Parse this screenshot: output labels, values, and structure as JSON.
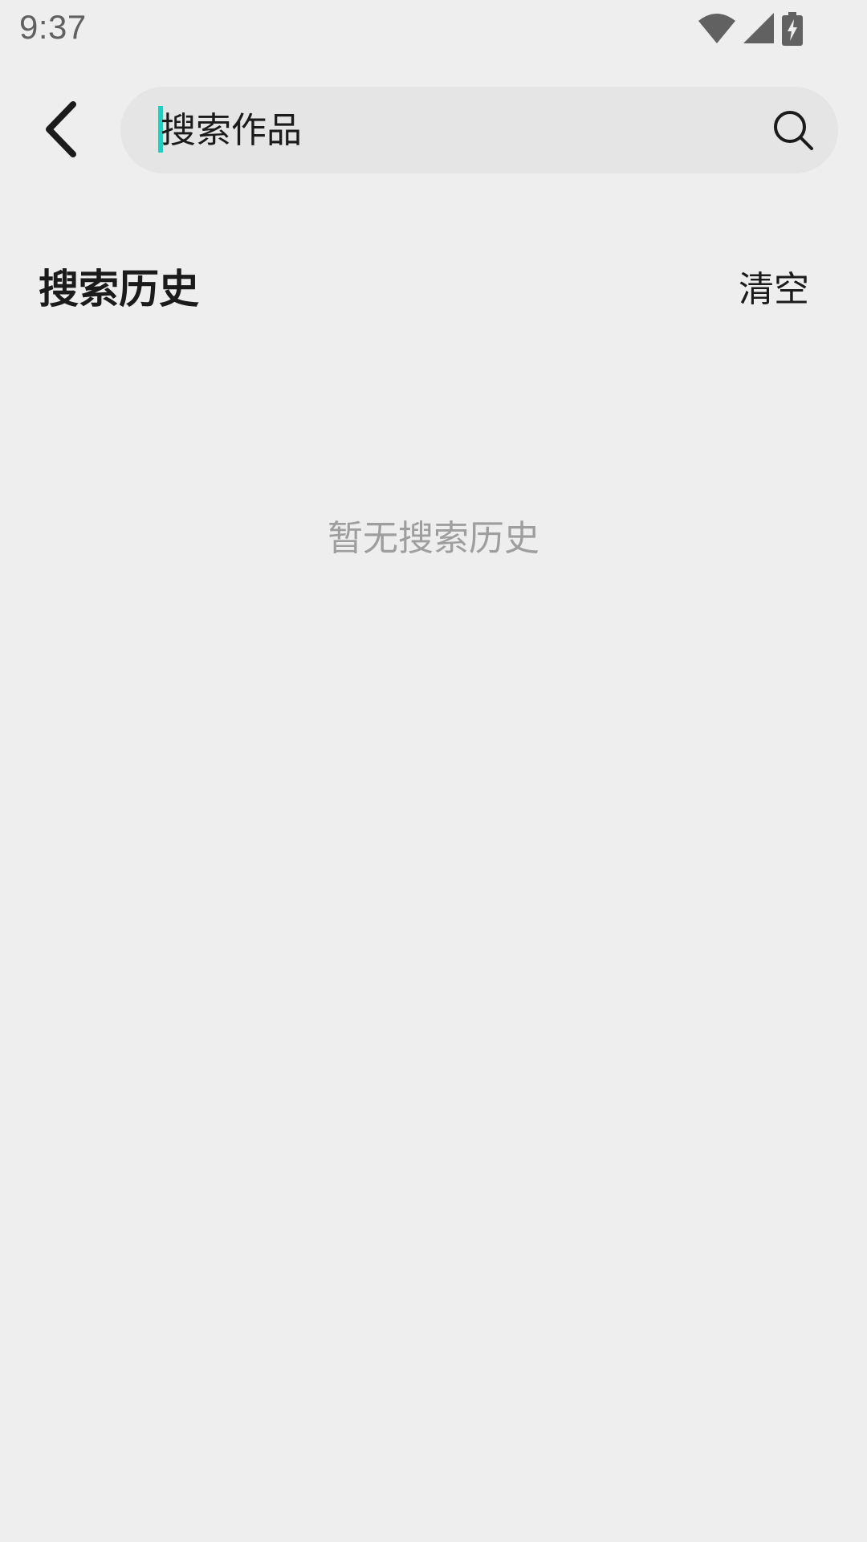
{
  "status_bar": {
    "time": "9:37",
    "icons": [
      "wifi-icon",
      "cellular-signal-icon",
      "battery-charging-icon"
    ]
  },
  "header": {
    "back_icon": "chevron-left-icon",
    "search": {
      "placeholder": "搜索作品",
      "value": "",
      "icon": "search-icon",
      "caret_color": "#1FCFC0"
    }
  },
  "history": {
    "title": "搜索历史",
    "clear_label": "清空",
    "empty_text": "暂无搜索历史",
    "items": []
  },
  "colors": {
    "background": "#EEEEEE",
    "search_box": "#E5E5E5",
    "primary_text": "#1B1B1B",
    "muted_text": "#9E9E9E",
    "accent": "#1FCFC0"
  }
}
